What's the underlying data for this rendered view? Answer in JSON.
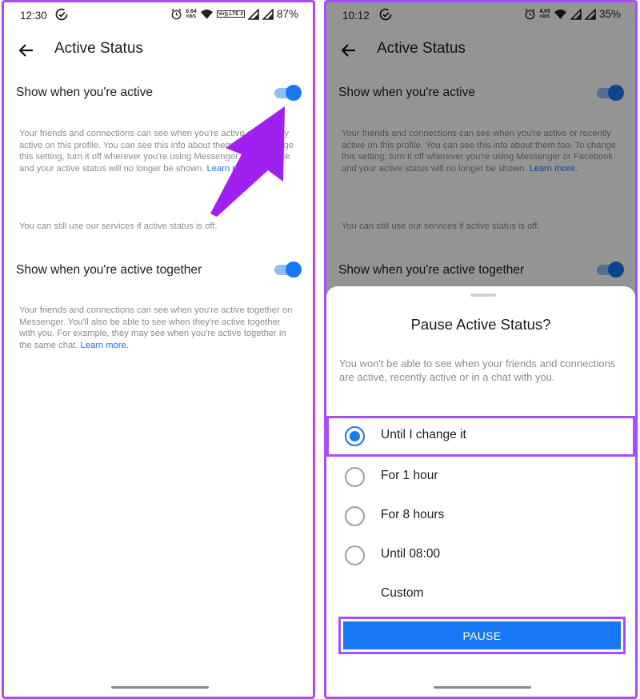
{
  "left_screen": {
    "status_bar": {
      "time": "12:30",
      "speed": "0.64",
      "speed_unit": "KB/S",
      "lte": "Vo)) LTE 2",
      "battery": "87%"
    },
    "header": {
      "title": "Active Status"
    },
    "settings": [
      {
        "title": "Show when you're active",
        "enabled": true,
        "description": "Your friends and connections can see when you're active or recently active on this profile. You can see this info about them too. To change this setting, turn it off wherever you're using Messenger or Facebook and your active status will no longer be shown.",
        "link": "Learn more."
      },
      {
        "title": "Show when you're active together",
        "enabled": true,
        "description": "Your friends and connections can see when you're active together on Messenger. You'll also be able to see when they're active together with you. For example, they may see when you're active together in the same chat.",
        "link": "Learn more."
      }
    ],
    "note": "You can still use our services if active status is off."
  },
  "right_screen": {
    "status_bar": {
      "time": "10:12",
      "speed": "4.00",
      "speed_unit": "KB/S",
      "battery": "35%"
    },
    "sheet": {
      "title": "Pause Active Status?",
      "description": "You won't be able to see when your friends and connections are active, recently active or in a chat with you.",
      "options": [
        {
          "label": "Until I change it",
          "selected": true
        },
        {
          "label": "For 1 hour",
          "selected": false
        },
        {
          "label": "For 8 hours",
          "selected": false
        },
        {
          "label": "Until 08:00",
          "selected": false
        },
        {
          "label": "Custom",
          "selected": false
        }
      ],
      "pause_label": "PAUSE"
    }
  },
  "colors": {
    "accent": "#1877f2",
    "highlight": "#a64dff",
    "muted_text": "#8a8d91"
  }
}
